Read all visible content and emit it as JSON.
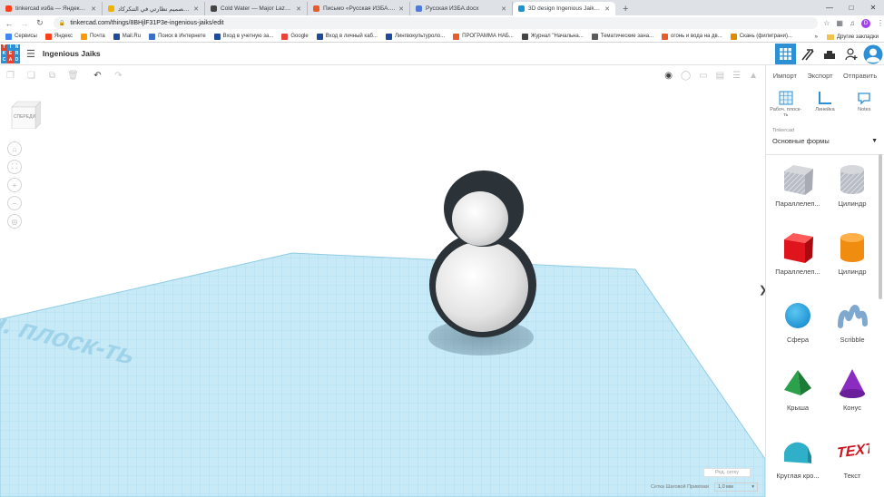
{
  "browser": {
    "tabs": [
      {
        "title": "tinkercad изба — Яндекс: нашлось",
        "favicon_color": "#fc3f1d",
        "active": false
      },
      {
        "title": "‫تصميم نظارتي في التنكركاد‬ (video)",
        "favicon_color": "#f0b400",
        "active": false
      },
      {
        "title": "Cold Water — Major Lazer...",
        "favicon_color": "#444444",
        "active": false
      },
      {
        "title": "Письмо «Русская ИЗБА.docx» — ...",
        "favicon_color": "#e85b2a",
        "active": false
      },
      {
        "title": "Русская ИЗБА.docx",
        "favicon_color": "#4e7bd8",
        "active": false
      },
      {
        "title": "3D design Ingenious Jaiks | Tinke...",
        "favicon_color": "#1c94d2",
        "active": true
      }
    ],
    "new_tab_glyph": "+",
    "url": "tinkercad.com/things/8BHjlF31P3e-ingenious-jaiks/edit",
    "profile_letter": "D",
    "bookmarks": [
      {
        "label": "Сервисы",
        "color": "#4285f4"
      },
      {
        "label": "Яндекс",
        "color": "#fc3f1d"
      },
      {
        "label": "Почта",
        "color": "#ff9900"
      },
      {
        "label": "Mail.Ru",
        "color": "#1f4b9d"
      },
      {
        "label": "Поиск в Интернете",
        "color": "#3b6fc5"
      },
      {
        "label": "Вход в учетную за...",
        "color": "#1f4b9d"
      },
      {
        "label": "Google",
        "color": "#ea4335"
      },
      {
        "label": "Вход в личный каб...",
        "color": "#1f4b9d"
      },
      {
        "label": "Лингвокультуроло...",
        "color": "#1f4b9d"
      },
      {
        "label": "ПРОГРАММА НАБ...",
        "color": "#e85b2a"
      },
      {
        "label": "Журнал \"Начальна...",
        "color": "#444444"
      },
      {
        "label": "Тематические зана...",
        "color": "#5b5b5b"
      },
      {
        "label": "огонь и вода на дв...",
        "color": "#e85b2a"
      },
      {
        "label": "Скань (филиграни)...",
        "color": "#e08a00"
      }
    ],
    "bookmarks_more": "»",
    "other_bookmarks": "Другие закладки"
  },
  "app": {
    "logo_letters": [
      "T",
      "I",
      "N",
      "K",
      "E",
      "R",
      "C",
      "A",
      "D"
    ],
    "logo_colors": [
      "#e8412b",
      "#2d90d4",
      "#2d90d4",
      "#2d90d4",
      "#e8412b",
      "#2d90d4",
      "#2d90d4",
      "#e8412b",
      "#2d90d4"
    ],
    "design_name": "Ingenious Jaiks",
    "viewcube_label": "СПЕРЕДИ",
    "workplane_label": "Рабоч. плоск-ть",
    "edit_grid_label": "Ред. сетку",
    "snap_label": "Сетка Шаговой Привязки",
    "snap_value": "1,0 мм",
    "collapse_glyph": "❯"
  },
  "right_panel": {
    "tabs": {
      "import": "Импорт",
      "export": "Экспорт",
      "send": "Отправить"
    },
    "tools": {
      "workplane": "Рабоч. плоск-ть",
      "ruler": "Линейка",
      "notes": "Notes"
    },
    "library_label": "Tinkercad",
    "library_value": "Основные формы",
    "shapes": [
      {
        "label": "Параллелеп...",
        "icon": "box-hole-icon",
        "color": "#b8bcc4"
      },
      {
        "label": "Цилиндр",
        "icon": "cylinder-hole-icon",
        "color": "#b8bcc4"
      },
      {
        "label": "Параллелеп...",
        "icon": "box-icon",
        "color": "#e0141c"
      },
      {
        "label": "Цилиндр",
        "icon": "cylinder-icon",
        "color": "#f08c10"
      },
      {
        "label": "Сфера",
        "icon": "sphere-icon",
        "color": "#1a8fd0"
      },
      {
        "label": "Scribble",
        "icon": "scribble-icon",
        "color": "#7fa8cf"
      },
      {
        "label": "Крыша",
        "icon": "roof-icon",
        "color": "#2aa14a"
      },
      {
        "label": "Конус",
        "icon": "cone-icon",
        "color": "#8a2cc0"
      },
      {
        "label": "Круглая кро...",
        "icon": "round-roof-icon",
        "color": "#30b0c8"
      },
      {
        "label": "Текст",
        "icon": "text-icon",
        "color": "#cc1420"
      }
    ]
  },
  "colors": {
    "accent": "#2d90d4",
    "grid": "#b9e4f4"
  }
}
